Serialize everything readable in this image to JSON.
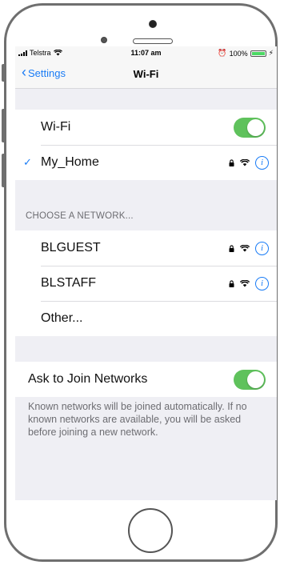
{
  "status_bar": {
    "carrier": "Telstra",
    "time": "11:07 am",
    "battery": "100%",
    "icons": [
      "signal-icon",
      "wifi-icon",
      "alarm-icon",
      "battery-icon",
      "charging-icon"
    ]
  },
  "nav": {
    "back_label": "Settings",
    "title": "Wi-Fi"
  },
  "wifi_toggle": {
    "label": "Wi-Fi",
    "on": true
  },
  "connected": {
    "name": "My_Home",
    "secured": true
  },
  "networks_header": "CHOOSE A NETWORK...",
  "networks": [
    {
      "name": "BLGUEST",
      "secured": true
    },
    {
      "name": "BLSTAFF",
      "secured": true
    },
    {
      "name": "Other..."
    }
  ],
  "ask_to_join": {
    "label": "Ask to Join Networks",
    "on": true,
    "note": "Known networks will be joined automatically. If no known networks are available, you will be asked before joining a new network."
  },
  "colors": {
    "accent": "#1a7cf6",
    "toggle_on": "#5fc25c",
    "background": "#efeff4"
  }
}
